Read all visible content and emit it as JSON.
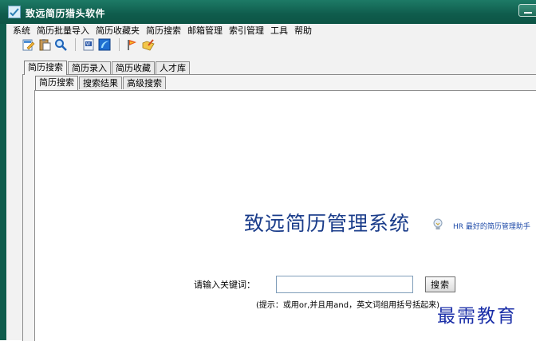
{
  "window": {
    "title": "致远简历猎头软件"
  },
  "menubar": {
    "items": [
      "系统",
      "简历批量导入",
      "简历收藏夹",
      "简历搜索",
      "邮箱管理",
      "索引管理",
      "工具",
      "帮助"
    ]
  },
  "toolbar": {
    "icons": [
      "edit-doc-icon",
      "clipboard-icon",
      "magnifier-icon",
      "word-doc-icon",
      "ie-browser-icon",
      "flag-icon",
      "folder-pencil-icon"
    ]
  },
  "tabs_outer": {
    "items": [
      "简历搜索",
      "简历录入",
      "简历收藏",
      "人才库"
    ],
    "active": 0
  },
  "tabs_inner": {
    "items": [
      "简历搜索",
      "搜索结果",
      "高级搜索"
    ],
    "active": 0
  },
  "main": {
    "heading": "致远简历管理系统",
    "tagline": "HR 最好的简历管理助手",
    "keyword_label": "请输入关键词：",
    "keyword_value": "",
    "search_button": "搜索",
    "hint": "(提示：或用or,并且用and，英文词组用括号括起来)"
  },
  "watermark": "最需教育",
  "colors": {
    "titlebar": "#0f5c4c",
    "heading": "#1a3c8a",
    "watermark": "#1b2fa8"
  }
}
